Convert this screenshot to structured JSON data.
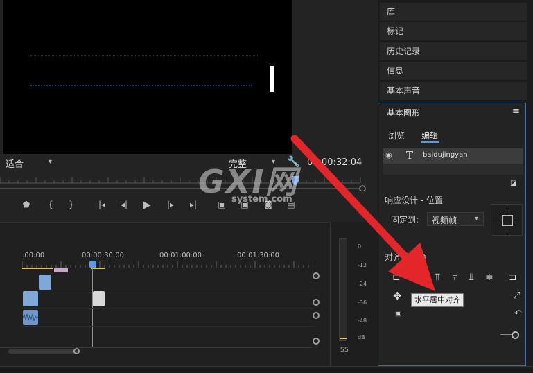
{
  "monitor": {
    "fit_label": "适合",
    "quality_label": "完整",
    "timecode": "00:00:32:04"
  },
  "timeline": {
    "ruler_labels": [
      ":00:00",
      "00:00:30:00",
      "00:01:00:00",
      "00:01:30:00"
    ]
  },
  "meter": {
    "scale": [
      "0",
      "-12",
      "-24",
      "-36",
      "-48",
      "dB"
    ],
    "solo_labels": [
      "S",
      "S"
    ]
  },
  "panels": {
    "items": [
      "库",
      "标记",
      "历史记录",
      "信息",
      "基本声音"
    ]
  },
  "essential_graphics": {
    "title": "基本图形",
    "tabs": [
      "浏览",
      "编辑"
    ],
    "layer_name": "baidujingyan",
    "responsive_label": "响应设计 - 位置",
    "pin_to_label": "固定到:",
    "pin_to_value": "视频帧",
    "align_section_label": "对齐并变换",
    "tooltip": "水平居中对齐"
  },
  "watermark": {
    "main": "GXI网",
    "sub": "system.com"
  },
  "colors": {
    "accent_blue": "#3a6ea5",
    "clip_blue": "#7fa8d8",
    "arrow_red": "#e3262a"
  }
}
